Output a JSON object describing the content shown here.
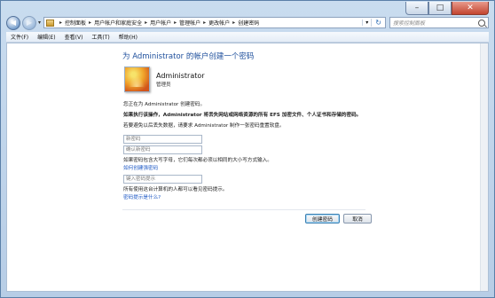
{
  "window": {
    "controls": {
      "minimize": "–",
      "maximize": "□",
      "close": "✕"
    }
  },
  "nav": {
    "back": "◀",
    "forward": "▶",
    "dropdown": "▾",
    "breadcrumbs": [
      "控制面板",
      "用户帐户和家庭安全",
      "用户帐户",
      "管理帐户",
      "更改帐户",
      "创建密码"
    ],
    "separator": "▸",
    "refresh": "↻",
    "search_placeholder": "搜索控制面板"
  },
  "menubar": {
    "items": [
      "文件(F)",
      "编辑(E)",
      "查看(V)",
      "工具(T)",
      "帮助(H)"
    ]
  },
  "page": {
    "title": "为 Administrator 的帐户创建一个密码",
    "user_name": "Administrator",
    "user_role": "管理员",
    "line1": "您正在为 Administrator 创建密码。",
    "line2_bold": "如果执行该操作，Administrator 将丢失网站或网络资源的所有 EFS 加密文件、个人证书和存储的密码。",
    "line3": "若要避免以后丢失数据，请要求 Administrator 制作一张密码重置软盘。",
    "new_password_placeholder": "新密码",
    "confirm_password_placeholder": "确认新密码",
    "case_hint": "如果密码包含大写字母，它们每次都必须以相同的大小写方式输入。",
    "strong_password_link": "如何创建强密码",
    "hint_placeholder": "键入密码提示",
    "hint_note": "所有使用这台计算机的人都可以看见密码提示。",
    "hint_link": "密码提示是什么?",
    "create_button": "创建密码",
    "cancel_button": "取消"
  }
}
